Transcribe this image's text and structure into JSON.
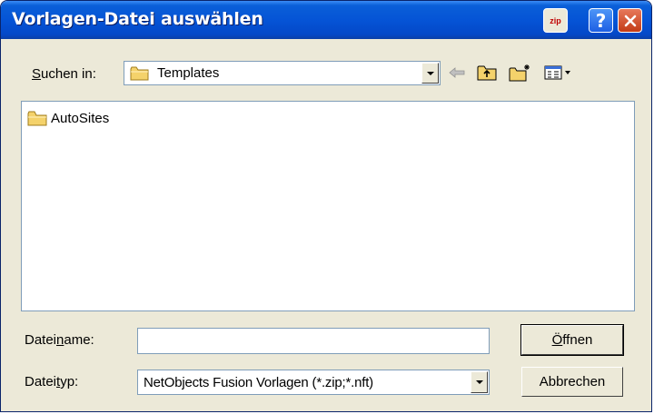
{
  "window": {
    "title": "Vorlagen-Datei auswählen",
    "zip_badge": "zip",
    "help_label": "?"
  },
  "lookin": {
    "label_accel": "S",
    "label_rest": "uchen in:",
    "value": "Templates"
  },
  "toolbar": {
    "icons": [
      "back-arrow-icon",
      "up-folder-icon",
      "new-folder-icon",
      "view-menu-icon"
    ]
  },
  "files": [
    {
      "name": "AutoSites",
      "icon": "folder-icon"
    }
  ],
  "filename": {
    "label_pre": "Datei",
    "label_accel": "n",
    "label_post": "ame:",
    "value": ""
  },
  "filetype": {
    "label_pre": "Datei",
    "label_accel": "t",
    "label_post": "yp:",
    "value": "NetObjects Fusion Vorlagen (*.zip;*.nft)"
  },
  "buttons": {
    "open_accel": "Ö",
    "open_rest": "ffnen",
    "cancel": "Abbrechen"
  },
  "colors": {
    "titlebar": "#0554d6",
    "dialog_bg": "#ece9d8",
    "close": "#c33b16",
    "folder": "#f4d26b"
  }
}
